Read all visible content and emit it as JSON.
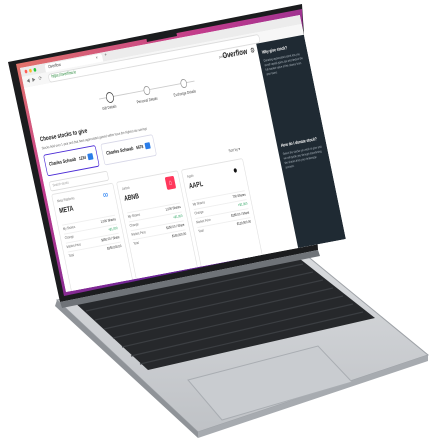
{
  "browser": {
    "tab_title": "Overflow",
    "tab_close": "×",
    "new_tab": "+",
    "url": "https://overflow.io"
  },
  "brand": {
    "powered_by": "powered by",
    "logo": "Overflow"
  },
  "steps": [
    {
      "label": "Gift Details"
    },
    {
      "label": "Personal Details"
    },
    {
      "label": "Exchange Details"
    }
  ],
  "choose": {
    "title": "Choose stocks to give",
    "subtitle": "Stocks held over 1 year and that have appreciated gained within have the highest tax savings"
  },
  "brokers": [
    {
      "name": "Charles Schwab",
      "number": "1234",
      "selected": true
    },
    {
      "name": "Charles Schwab",
      "number": "5678",
      "selected": false
    }
  ],
  "search": {
    "placeholder": "Search stocks"
  },
  "sort": {
    "label": "Sort by ▾"
  },
  "cards": [
    {
      "ticker": "META",
      "company": "Meta Platforms",
      "logo_icon": "meta-logo-icon",
      "rows": [
        {
          "k": "My Shares",
          "v": "1,000 Shares"
        },
        {
          "k": "Change",
          "v": "+$1,000"
        },
        {
          "k": "Market Price",
          "v": "$350.00 / Share"
        },
        {
          "k": "Total",
          "v": "$350,000.00"
        }
      ]
    },
    {
      "ticker": "ABNB",
      "company": "Airbnb",
      "logo_icon": "airbnb-logo-icon",
      "rows": [
        {
          "k": "My Shares",
          "v": "1,000 Shares"
        },
        {
          "k": "Change",
          "v": "+$1,000"
        },
        {
          "k": "Market Price",
          "v": "$150.00 / Share"
        },
        {
          "k": "Total",
          "v": "$150,000.00"
        }
      ]
    },
    {
      "ticker": "AAPL",
      "company": "Apple",
      "logo_icon": "apple-logo-icon",
      "rows": [
        {
          "k": "My Shares",
          "v": "700 Shares"
        },
        {
          "k": "Change",
          "v": "+$1,000"
        },
        {
          "k": "Market Price",
          "v": "$185.00 / Share"
        },
        {
          "k": "Total",
          "v": "$129,500.00"
        }
      ]
    }
  ],
  "sidebar": {
    "heading1": "Why give stock?",
    "para1": "Donating appreciated stock lets you avoid capital gains tax and deduct the full market value of the shares from your taxes.",
    "heading2": "How do I donate stock?",
    "para2": "Select the stocks you wish to give and we will guide you through transferring the shares from your brokerage account."
  },
  "colors": {
    "accent": "#4b2bd6",
    "sidebar_bg": "#1f2a33",
    "positive": "#1e9e57",
    "wallpaper_purple": "#7b2b9a"
  }
}
